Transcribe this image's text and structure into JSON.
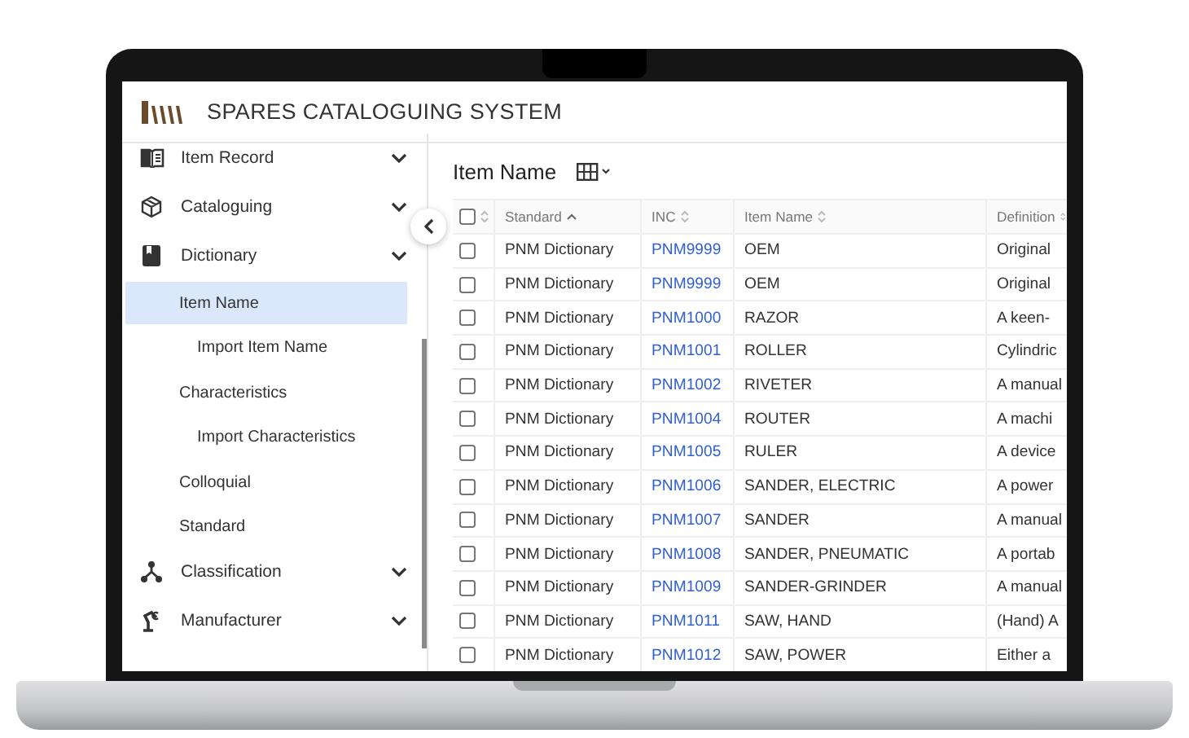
{
  "app": {
    "title": "SPARES CATALOGUING SYSTEM"
  },
  "sidebar": {
    "items": [
      {
        "label": "Item Record",
        "selected": false
      },
      {
        "label": "Cataloguing",
        "selected": false
      },
      {
        "label": "Dictionary",
        "selected": false,
        "children": [
          {
            "label": "Item Name",
            "selected": true,
            "children": [
              {
                "label": "Import Item Name",
                "selected": false
              }
            ]
          },
          {
            "label": "Characteristics",
            "selected": false,
            "children": [
              {
                "label": "Import Characteristics",
                "selected": false
              }
            ]
          },
          {
            "label": "Colloquial",
            "selected": false
          },
          {
            "label": "Standard",
            "selected": false
          }
        ]
      },
      {
        "label": "Classification",
        "selected": false
      },
      {
        "label": "Manufacturer",
        "selected": false
      }
    ]
  },
  "page": {
    "title": "Item Name"
  },
  "table": {
    "all_checked": false,
    "columns": [
      {
        "label": "Standard",
        "sorted": true
      },
      {
        "label": "INC",
        "sorted": false
      },
      {
        "label": "Item Name",
        "sorted": false
      },
      {
        "label": "Definition",
        "sorted": false
      }
    ],
    "rows": [
      {
        "checked": false,
        "standard": "PNM Dictionary",
        "inc": "PNM9999",
        "item_name": "OEM",
        "definition": "Original"
      },
      {
        "checked": false,
        "standard": "PNM Dictionary",
        "inc": "PNM9999",
        "item_name": "OEM",
        "definition": "Original"
      },
      {
        "checked": false,
        "standard": "PNM Dictionary",
        "inc": "PNM1000",
        "item_name": "RAZOR",
        "definition": "A keen-"
      },
      {
        "checked": false,
        "standard": "PNM Dictionary",
        "inc": "PNM1001",
        "item_name": "ROLLER",
        "definition": "Cylindric"
      },
      {
        "checked": false,
        "standard": "PNM Dictionary",
        "inc": "PNM1002",
        "item_name": "RIVETER",
        "definition": "A manual"
      },
      {
        "checked": false,
        "standard": "PNM Dictionary",
        "inc": "PNM1004",
        "item_name": "ROUTER",
        "definition": "A machi"
      },
      {
        "checked": false,
        "standard": "PNM Dictionary",
        "inc": "PNM1005",
        "item_name": "RULER",
        "definition": "A device"
      },
      {
        "checked": false,
        "standard": "PNM Dictionary",
        "inc": "PNM1006",
        "item_name": "SANDER, ELECTRIC",
        "definition": "A power"
      },
      {
        "checked": false,
        "standard": "PNM Dictionary",
        "inc": "PNM1007",
        "item_name": "SANDER",
        "definition": "A manual"
      },
      {
        "checked": false,
        "standard": "PNM Dictionary",
        "inc": "PNM1008",
        "item_name": "SANDER, PNEUMATIC",
        "definition": "A portab"
      },
      {
        "checked": false,
        "standard": "PNM Dictionary",
        "inc": "PNM1009",
        "item_name": "SANDER-GRINDER",
        "definition": "A manual"
      },
      {
        "checked": false,
        "standard": "PNM Dictionary",
        "inc": "PNM1011",
        "item_name": "SAW, HAND",
        "definition": "(Hand) A"
      },
      {
        "checked": false,
        "standard": "PNM Dictionary",
        "inc": "PNM1012",
        "item_name": "SAW, POWER",
        "definition": "Either a"
      }
    ]
  }
}
